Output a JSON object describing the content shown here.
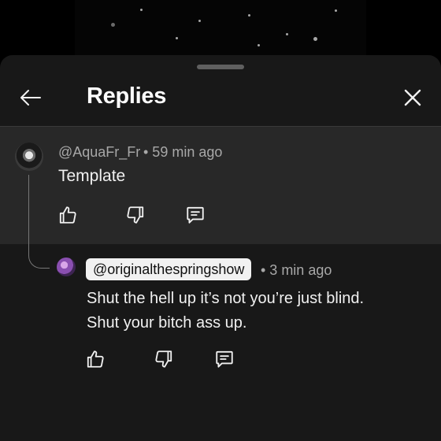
{
  "header": {
    "title": "Replies"
  },
  "parent_comment": {
    "author": "@AquaFr_Fr",
    "time": "• 59 min ago",
    "text": "Template",
    "avatar_icon": "user-avatar"
  },
  "reply": {
    "author": "@originalthespringshow",
    "time": "• 3 min ago",
    "lines": [
      "Shut the hell up it’s not you’re just blind.",
      "Shut your bitch ass up."
    ],
    "avatar_icon": "user-avatar"
  },
  "icons": {
    "back": "arrow-left-icon",
    "close": "close-icon",
    "like": "thumbs-up-icon",
    "dislike": "thumbs-down-icon",
    "reply": "comment-reply-icon"
  },
  "colors": {
    "sheet_bg": "#181818",
    "highlight_bg": "#282828",
    "text_primary": "#f1f1f1",
    "text_secondary": "#a8a8a8",
    "chip_bg": "#f1f1f1"
  }
}
